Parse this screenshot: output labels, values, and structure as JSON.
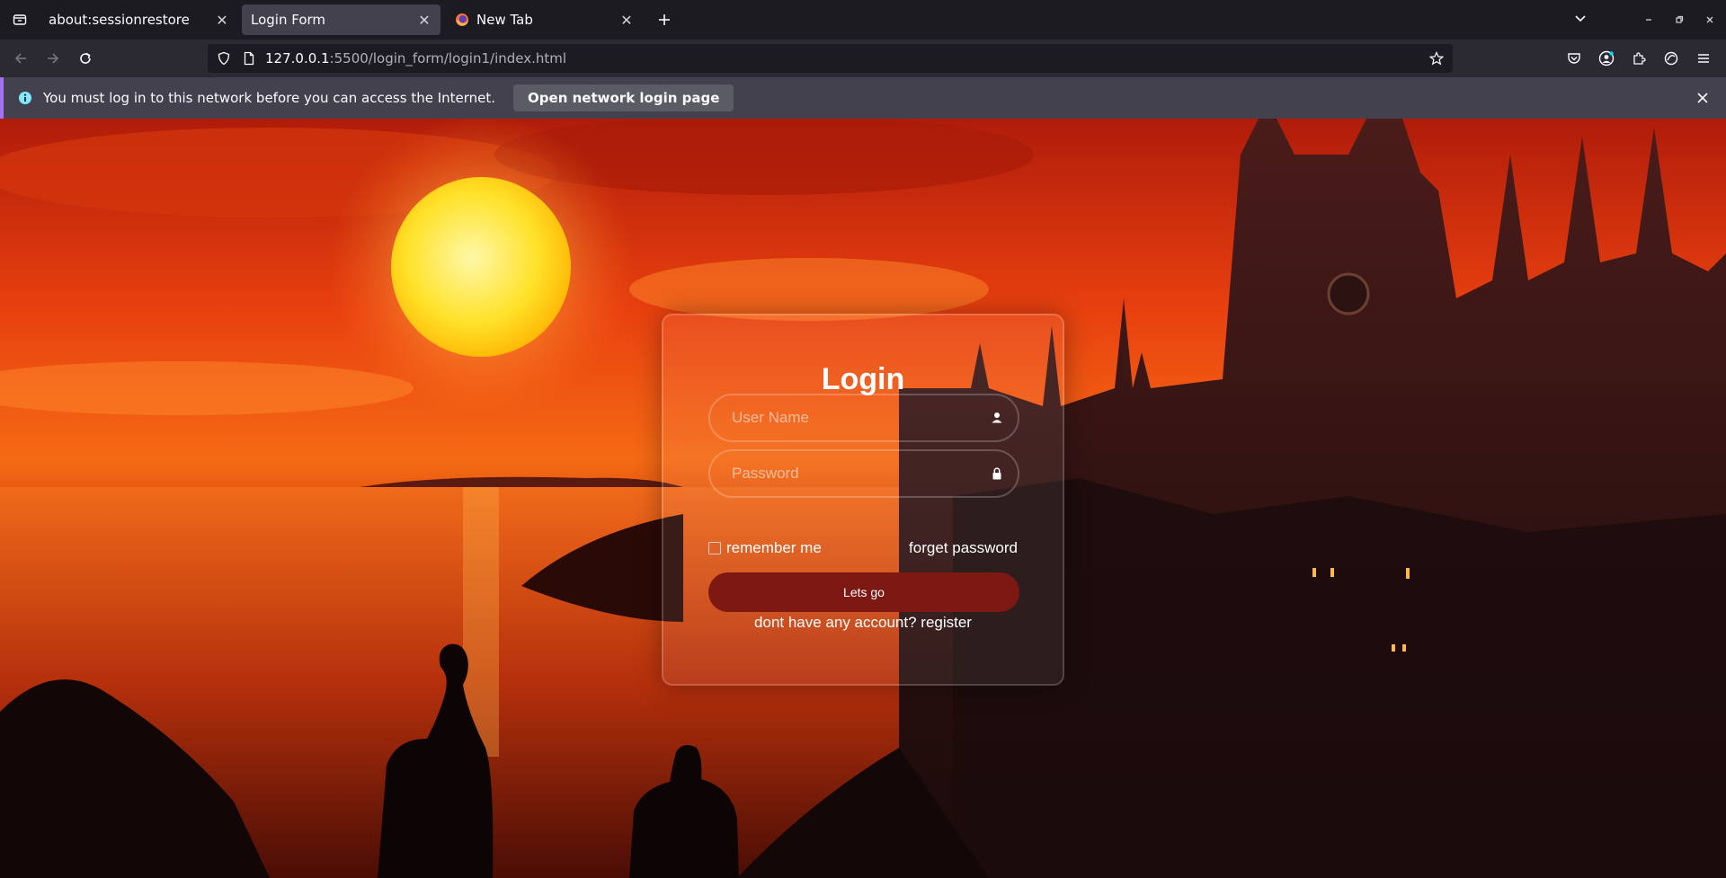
{
  "browser": {
    "tabs": [
      {
        "title": "about:sessionrestore",
        "active": false
      },
      {
        "title": "Login Form",
        "active": true
      },
      {
        "title": "New Tab",
        "active": false
      }
    ],
    "url_host": "127.0.0.1",
    "url_path": ":5500/login_form/login1/index.html"
  },
  "notification": {
    "message": "You must log in to this network before you can access the Internet.",
    "button_label": "Open network login page"
  },
  "login": {
    "title": "Login",
    "username_placeholder": "User Name",
    "password_placeholder": "Password",
    "remember_label": "remember me",
    "forget_label": "forget password",
    "submit_label": "Lets go",
    "register_text": "dont have any account? register"
  },
  "colors": {
    "accent_notification": "#a372f3",
    "button_red": "#7d1812",
    "chrome_dark": "#1c1b22"
  }
}
